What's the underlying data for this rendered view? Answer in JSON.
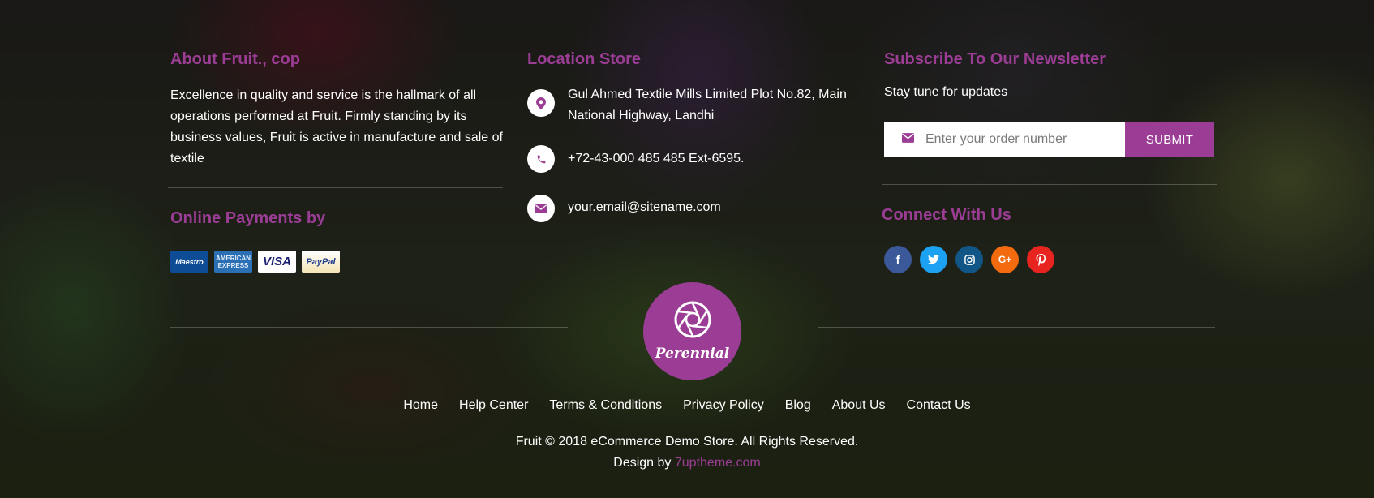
{
  "about": {
    "title": "About Fruit., cop",
    "text": "Excellence in quality and service is the hallmark of all operations performed at Fruit. Firmly standing by its business values, Fruit is active in manufacture and sale of textile"
  },
  "payments": {
    "title": "Online Payments by",
    "cards": [
      {
        "name": "maestro",
        "label": "Maestro"
      },
      {
        "name": "american-express",
        "label": "AMERICAN EXPRESS"
      },
      {
        "name": "visa",
        "label": "VISA"
      },
      {
        "name": "paypal",
        "label": "PayPal"
      }
    ]
  },
  "location": {
    "title": "Location Store",
    "address": "Gul Ahmed Textile Mills Limited Plot No.82, Main National Highway, Landhi",
    "phone": "+72-43-000 485 485 Ext-6595.",
    "email": "your.email@sitename.com"
  },
  "newsletter": {
    "title": "Subscribe To Our Newsletter",
    "text": "Stay tune for updates",
    "input_placeholder": "Enter your order number",
    "input_value": "",
    "submit_label": "SUBMIT"
  },
  "connect": {
    "title": "Connect With Us",
    "socials": [
      {
        "name": "facebook",
        "glyph": "f",
        "color": "#3b5998"
      },
      {
        "name": "twitter",
        "glyph": "t",
        "color": "#1da1f2"
      },
      {
        "name": "instagram",
        "glyph": "ig",
        "color": "#125688"
      },
      {
        "name": "google-plus",
        "glyph": "G+",
        "color": "#f36b0e"
      },
      {
        "name": "pinterest",
        "glyph": "p",
        "color": "#e7241f"
      }
    ]
  },
  "logo": {
    "name": "Perennial",
    "icon": "camera-aperture-icon"
  },
  "footer_nav": [
    "Home",
    "Help Center",
    "Terms & Conditions",
    "Privacy Policy",
    "Blog",
    "About Us",
    "Contact Us"
  ],
  "copyright": {
    "text": "Fruit © 2018 eCommerce Demo Store. All Rights Reserved.",
    "design_prefix": "Design by",
    "design_link": "7uptheme.com"
  },
  "colors": {
    "accent": "#9b3d94",
    "text": "#ffffff"
  }
}
